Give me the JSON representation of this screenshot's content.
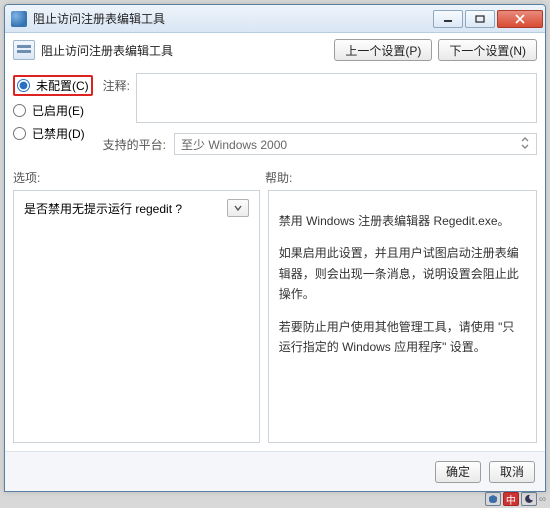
{
  "window": {
    "title": "阻止访问注册表编辑工具"
  },
  "header": {
    "setting_title": "阻止访问注册表编辑工具",
    "prev_label": "上一个设置(P)",
    "next_label": "下一个设置(N)"
  },
  "radios": {
    "not_configured": "未配置(C)",
    "enabled": "已启用(E)",
    "disabled": "已禁用(D)",
    "selected": "not_configured"
  },
  "comment": {
    "label": "注释:",
    "value": ""
  },
  "platform": {
    "label": "支持的平台:",
    "value": "至少 Windows 2000"
  },
  "sections": {
    "options_label": "选项:",
    "help_label": "帮助:"
  },
  "options": {
    "question": "是否禁用无提示运行 regedit ?"
  },
  "help": {
    "line1": "禁用 Windows 注册表编辑器 Regedit.exe。",
    "line2": "如果启用此设置，并且用户试图启动注册表编辑器，则会出现一条消息，说明设置会阻止此操作。",
    "line3": "若要防止用户使用其他管理工具，请使用 \"只运行指定的 Windows 应用程序\" 设置。"
  },
  "footer": {
    "ok_label": "确定",
    "cancel_label": "取消"
  },
  "tray": {
    "ime": "中"
  }
}
